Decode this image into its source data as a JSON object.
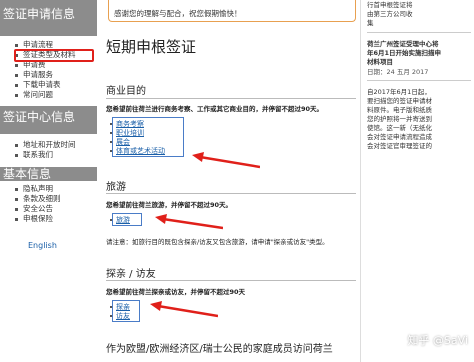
{
  "sidebar": {
    "visa_info_title": "签证申请信息",
    "visa_items": [
      "申请流程",
      "签证类型及材料",
      "申请费",
      "申请服务",
      "下载申请表",
      "常问问题"
    ],
    "center_title": "签证中心信息",
    "center_items": [
      "地址和开放时间",
      "联系我们"
    ],
    "basic_title": "基本信息",
    "basic_items": [
      "隐私声明",
      "条款及细则",
      "安全公告",
      "申根保险"
    ],
    "language": "English"
  },
  "notice": {
    "text": "感谢您的理解与配合，祝您假期愉快！"
  },
  "main": {
    "page_title": "短期申根签证",
    "sections": [
      {
        "title": "商业目的",
        "desc": "您希望前往荷兰进行商务考察、工作或其它商业目的，并停留不超过90天。",
        "links": [
          "商务考察",
          "职业培训",
          "展会",
          "体育或艺术活动"
        ]
      },
      {
        "title": "旅游",
        "desc": "您希望前往荷兰旅游，并停留不超过90天。",
        "links": [
          "旅游"
        ],
        "note": "请注意：如旅行目的既包含探亲/访友又包含旅游，请申请\"探亲或访友\"类型。"
      },
      {
        "title": "探亲 / 访友",
        "desc": "您希望前往荷兰探亲或访友，并停留不超过90天",
        "links": [
          "探亲",
          "访友"
        ]
      },
      {
        "title": "作为欧盟/欧洲经济区/瑞士公民的家庭成员访问荷兰"
      }
    ]
  },
  "right": {
    "lines_top": [
      "行首申根签证将",
      "由第三方公司收",
      "集"
    ],
    "news_title": [
      "荷兰广州签证受理中心将",
      "年6月1日开始实施扫描申",
      "材料项目"
    ],
    "news_date": "日期：24 五月 2017",
    "news_body": [
      "自2017年6月1日起，",
      "要扫描您的签证申请材",
      "料原件。电子版和纸质",
      "您的护照将一并寄送到",
      "使馆。这一新（无纸化",
      "会对签证申请流程造成",
      "会对签证官审理签证的"
    ]
  },
  "watermark": "知乎 @SaVi"
}
